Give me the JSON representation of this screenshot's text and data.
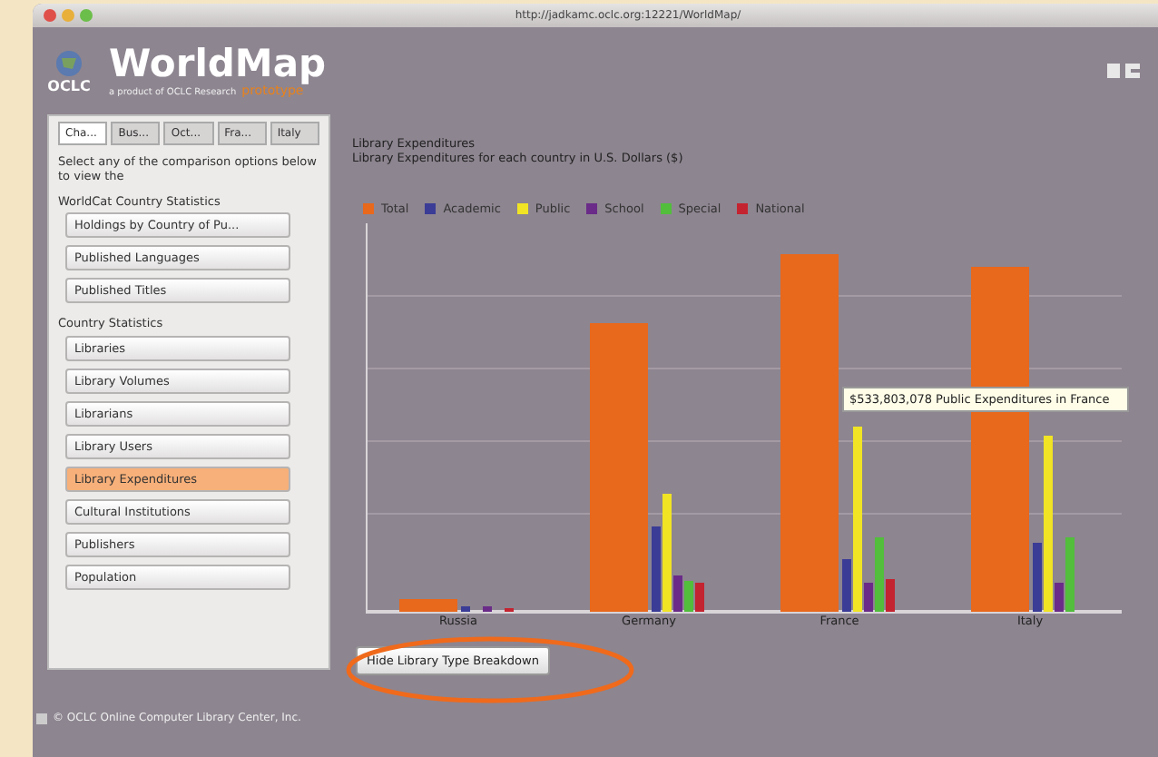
{
  "window": {
    "url": "http://jadkamc.oclc.org:12221/WorldMap/"
  },
  "header": {
    "org": "OCLC",
    "title": "WorldMap",
    "subtitle": "a product of OCLC Research",
    "tag": "prototype"
  },
  "tabs": [
    {
      "label": "Cha...",
      "selected": true
    },
    {
      "label": "Bus...",
      "selected": false
    },
    {
      "label": "Oct...",
      "selected": false
    },
    {
      "label": "Fra...",
      "selected": false
    },
    {
      "label": "Italy",
      "selected": false
    }
  ],
  "sidebar": {
    "intro": "Select any of the comparison options below to view the",
    "sections": [
      {
        "heading": "WorldCat Country Statistics",
        "items": [
          {
            "label": "Holdings by Country of Pu...",
            "selected": false
          },
          {
            "label": "Published Languages",
            "selected": false
          },
          {
            "label": "Published Titles",
            "selected": false
          }
        ]
      },
      {
        "heading": "Country Statistics",
        "items": [
          {
            "label": "Libraries",
            "selected": false
          },
          {
            "label": "Library Volumes",
            "selected": false
          },
          {
            "label": "Librarians",
            "selected": false
          },
          {
            "label": "Library Users",
            "selected": false
          },
          {
            "label": "Library Expenditures",
            "selected": true
          },
          {
            "label": "Cultural Institutions",
            "selected": false
          },
          {
            "label": "Publishers",
            "selected": false
          },
          {
            "label": "Population",
            "selected": false
          }
        ]
      }
    ]
  },
  "chart": {
    "title": "Library Expenditures",
    "subtitle": "Library Expenditures for each country in U.S. Dollars ($)",
    "legend": [
      {
        "label": "Total",
        "color": "#e8681c"
      },
      {
        "label": "Academic",
        "color": "#3a3c96"
      },
      {
        "label": "Public",
        "color": "#f0e424"
      },
      {
        "label": "School",
        "color": "#6a2c88"
      },
      {
        "label": "Special",
        "color": "#52be3c"
      },
      {
        "label": "National",
        "color": "#c42430"
      }
    ],
    "categories": [
      "Russia",
      "Germany",
      "France",
      "Italy"
    ],
    "tooltip": "$533,803,078 Public Expenditures in France"
  },
  "breakdown_button": "Hide Library Type Breakdown",
  "footer": "© OCLC Online Computer Library Center, Inc."
}
